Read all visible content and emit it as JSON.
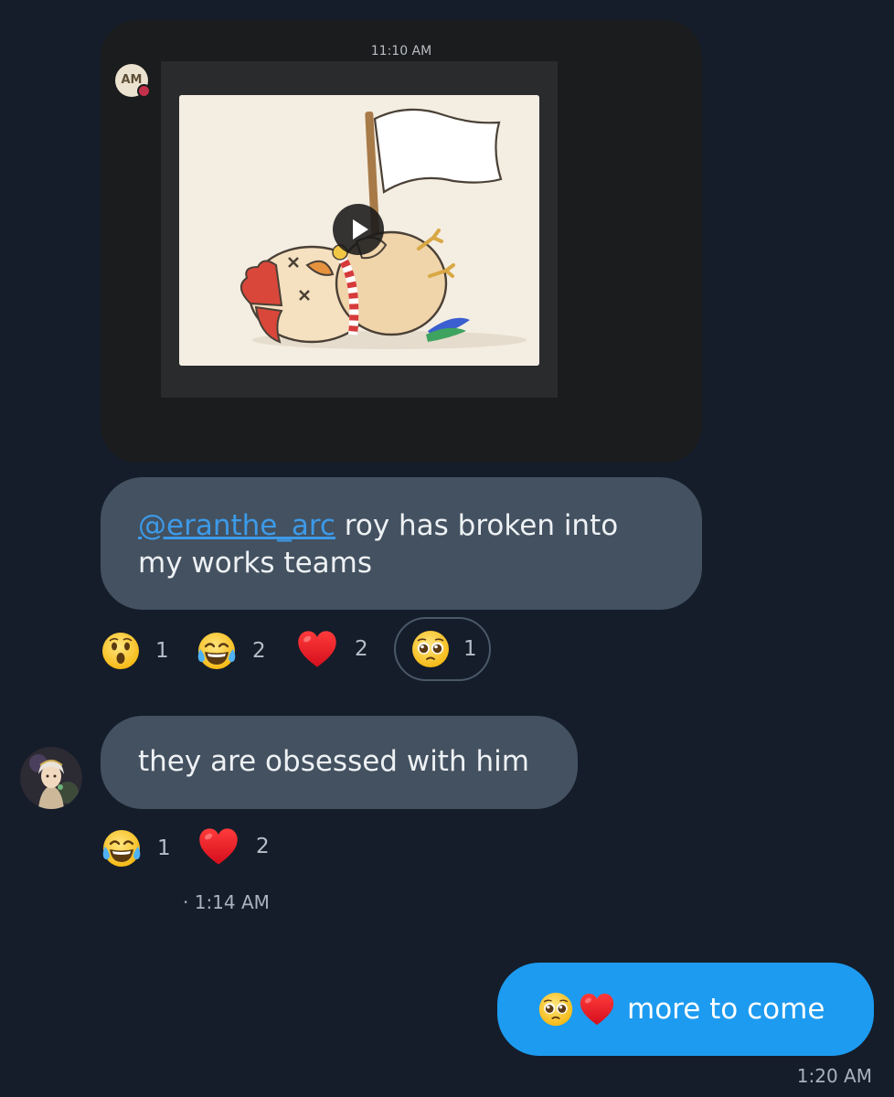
{
  "embed": {
    "time": "11:10 AM",
    "avatar_initials": "AM",
    "media_description": "animated sticker: chick lying down holding a white flag",
    "play_icon": "play-icon"
  },
  "messages": [
    {
      "mention": "@eranthe_arc",
      "text": " roy has broken into my works teams",
      "reactions": [
        {
          "emoji": "astonished-face",
          "count": "1"
        },
        {
          "emoji": "tears-of-joy-face",
          "count": "2"
        },
        {
          "emoji": "red-heart",
          "count": "2"
        },
        {
          "emoji": "pleading-face",
          "count": "1",
          "selected": true
        }
      ]
    },
    {
      "text": "they are obsessed with him",
      "reactions": [
        {
          "emoji": "tears-of-joy-face",
          "count": "1"
        },
        {
          "emoji": "red-heart",
          "count": "2"
        }
      ],
      "timestamp": "· 1:14 AM"
    }
  ],
  "sent": {
    "emojis": [
      "pleading-face",
      "red-heart"
    ],
    "text": "more to come",
    "timestamp": "1:20 AM"
  },
  "colors": {
    "background": "#151d2a",
    "received_bubble": "#435160",
    "sent_bubble": "#1d9bf0",
    "mention": "#3d9ae8"
  }
}
